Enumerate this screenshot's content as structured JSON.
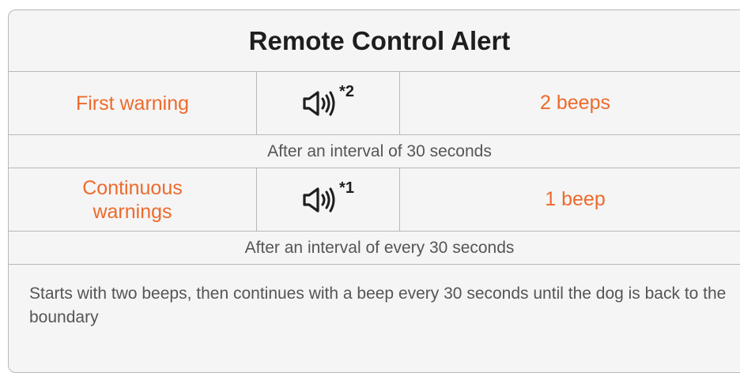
{
  "title": "Remote Control Alert",
  "rows": [
    {
      "label": "First warning",
      "icon": "speaker-icon",
      "footnote": "*2",
      "beeps": "2 beeps",
      "interval": "After an interval of 30 seconds"
    },
    {
      "label": "Continuous warnings",
      "icon": "speaker-icon",
      "footnote": "*1",
      "beeps": "1 beep",
      "interval": "After an interval of every 30 seconds"
    }
  ],
  "note": "Starts with two beeps, then continues with a beep every 30 seconds until the dog is back to the boundary",
  "colors": {
    "accent": "#ee6a2c",
    "text": "#1e1e1e",
    "muted": "#555555",
    "border": "#b8b8b8",
    "background": "#f5f5f5"
  }
}
